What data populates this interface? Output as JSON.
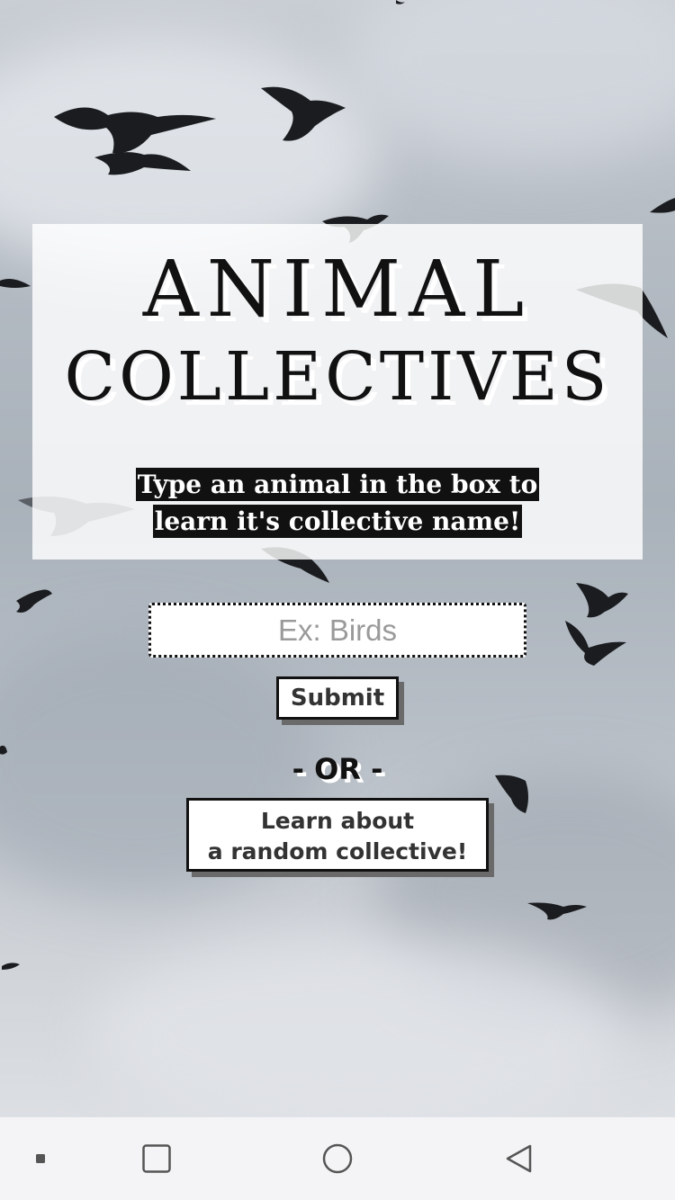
{
  "title": {
    "line1": "ANIMAL",
    "line2": "COLLECTIVES"
  },
  "instructions": {
    "line1": "Type an animal in the box to",
    "line2": "learn it's collective name!"
  },
  "search": {
    "placeholder": "Ex: Birds",
    "value": ""
  },
  "submit_label": "Submit",
  "or_text": "- OR -",
  "random_button": {
    "line1": "Learn about",
    "line2": "a random collective!"
  },
  "background_image": "flock of birds flying against a cloudy sky",
  "navbar": {
    "items": [
      {
        "icon": "menu-dot-icon"
      },
      {
        "icon": "recents-square-icon"
      },
      {
        "icon": "home-circle-icon"
      },
      {
        "icon": "back-triangle-icon"
      }
    ]
  },
  "colors": {
    "panel": "#ffffff",
    "text": "#111111",
    "button_shadow": "#6a6a6a",
    "navbar": "#f4f4f6"
  }
}
